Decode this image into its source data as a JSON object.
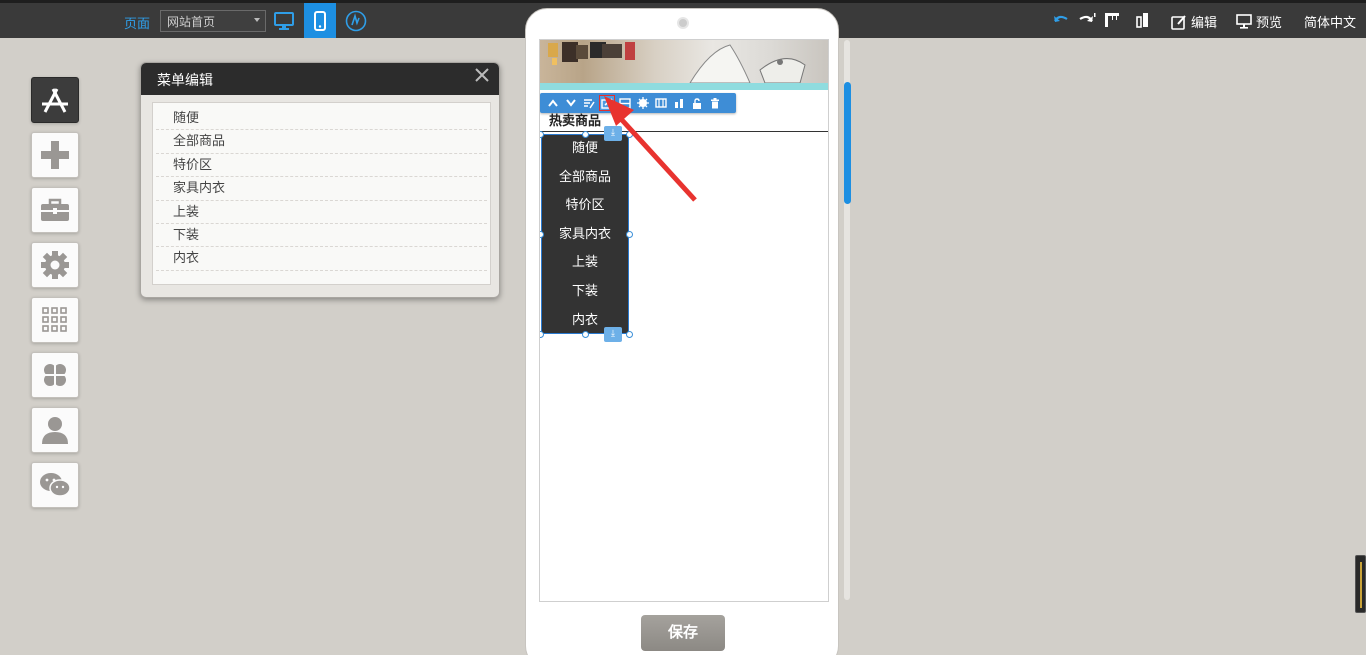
{
  "topbar": {
    "page_label": "页面",
    "page_select_value": "网站首页",
    "view_modes": [
      "desktop",
      "mobile",
      "wordpress"
    ],
    "right": {
      "edit_label": "编辑",
      "preview_label": "预览",
      "language_label": "简体中文"
    }
  },
  "left_toolbar": {
    "items": [
      "app-store-icon",
      "plus-icon",
      "toolbox-icon",
      "gear-icon",
      "grid-icon",
      "clover-icon",
      "user-icon",
      "wechat-icon"
    ]
  },
  "menu_panel": {
    "title": "菜单编辑",
    "items": [
      "随便",
      "全部商品",
      "特价区",
      "家具内衣",
      "上装",
      "下装",
      "内衣"
    ]
  },
  "phone": {
    "section_title": "热卖商品",
    "nav_items": [
      "随便",
      "全部商品",
      "特价区",
      "家具内衣",
      "上装",
      "下装",
      "内衣"
    ],
    "save_label": "保存"
  },
  "colors": {
    "accent": "#1d8fe2",
    "topbar": "#3a3a3a",
    "arrow": "#e8332f"
  }
}
